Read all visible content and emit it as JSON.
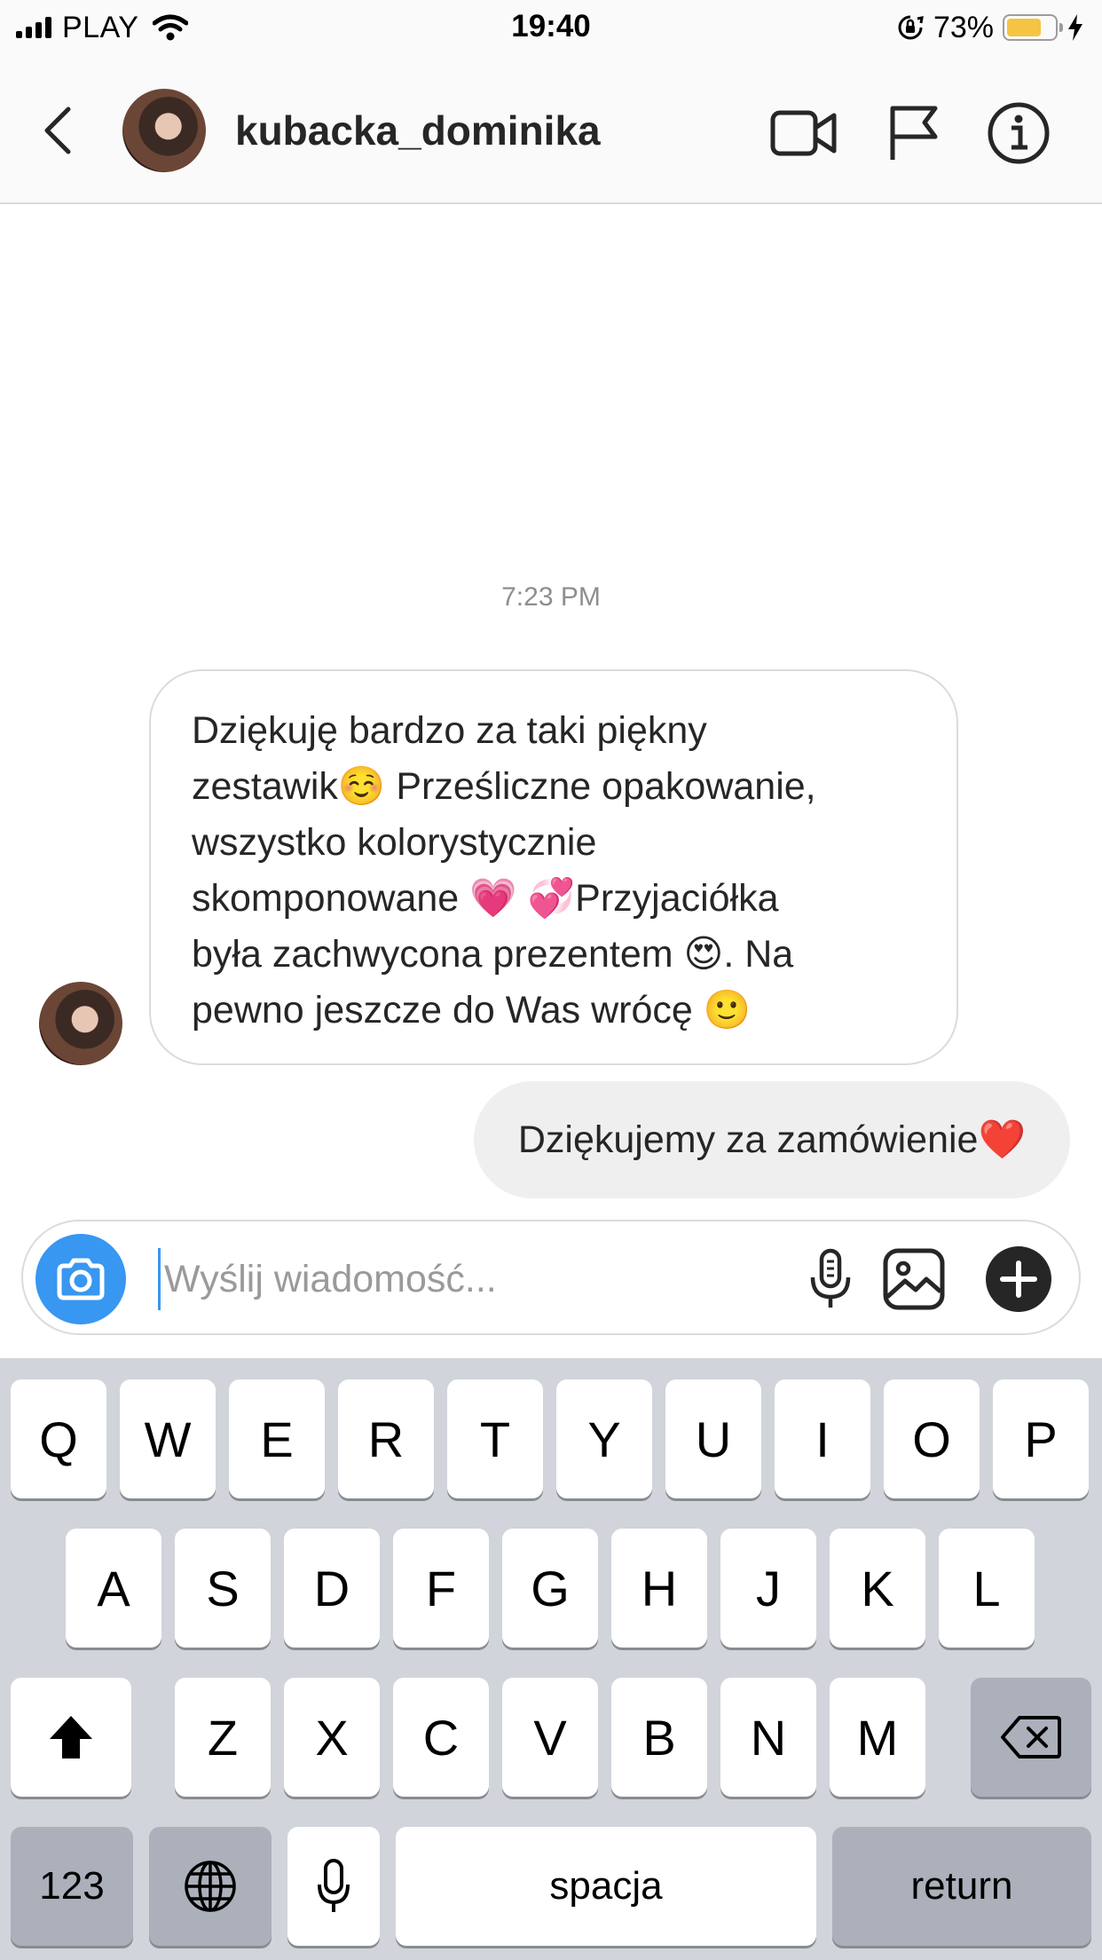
{
  "status_bar": {
    "carrier": "PLAY",
    "time": "19:40",
    "battery_percent": "73%",
    "battery_level": 0.73,
    "battery_color": "#f5c443"
  },
  "header": {
    "username": "kubacka_dominika",
    "icons": [
      "chevron-left-icon",
      "video-camera-icon",
      "flag-icon",
      "info-icon"
    ]
  },
  "chat": {
    "timestamp": "7:23 PM",
    "incoming_message": "Dziękuję bardzo za taki piękny\nzestawik☺️ Prześliczne opakowanie,\nwszystko kolorystycznie\nskomponowane 💗 💞Przyjaciółka\nbyła zachwycona prezentem 😍. Na\npewno jeszcze do Was wrócę 🙂",
    "outgoing_message": "Dziękujemy za zamówienie❤️"
  },
  "composer": {
    "placeholder": "Wyślij wiadomość...",
    "accent_color": "#3897f0"
  },
  "keyboard": {
    "row1": [
      "Q",
      "W",
      "E",
      "R",
      "T",
      "Y",
      "U",
      "I",
      "O",
      "P"
    ],
    "row2": [
      "A",
      "S",
      "D",
      "F",
      "G",
      "H",
      "J",
      "K",
      "L"
    ],
    "row3": [
      "Z",
      "X",
      "C",
      "V",
      "B",
      "N",
      "M"
    ],
    "numbers_label": "123",
    "space_label": "spacja",
    "return_label": "return"
  }
}
